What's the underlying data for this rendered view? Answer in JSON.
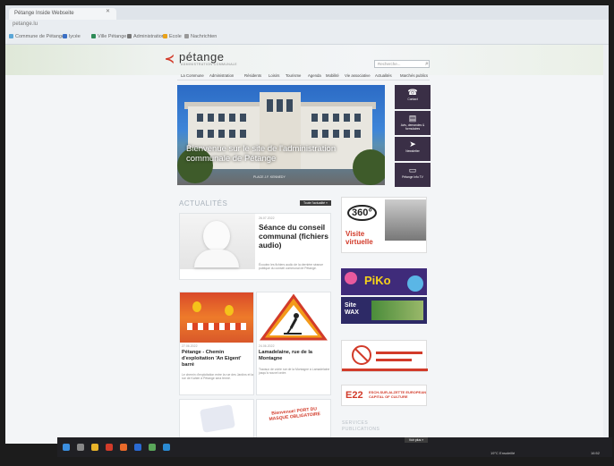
{
  "browser": {
    "tab_title": "Pétange Inside Webseite",
    "url_text": "petange.lu",
    "bookmarks": [
      "Commune de Pétange",
      "lycée",
      "Ville Pétange",
      "Administration",
      "Ecole",
      "Nachrichten"
    ]
  },
  "site": {
    "logo_text": "pétange",
    "logo_sub": "ADMINISTRATION COMMUNALE",
    "search_placeholder": "Recherche...",
    "nav": [
      "La Commune",
      "Administration",
      "Résidents",
      "Loisirs",
      "Tourisme",
      "Agenda",
      "Mobilité",
      "Vie associative",
      "Actualités",
      "Marchés publics"
    ],
    "hero": {
      "caption": "Bienvenue sur le site de l'administration communale de Pétange",
      "credit": "PLACE J.F. KENNEDY"
    },
    "side_buttons": [
      {
        "icon": "phone-book-icon",
        "glyph": "☎",
        "label": "Contact"
      },
      {
        "icon": "document-icon",
        "glyph": "▤",
        "label": "Avis, demandes & formulaires"
      },
      {
        "icon": "paper-plane-icon",
        "glyph": "➤",
        "label": "Newsletter"
      },
      {
        "icon": "tv-icon",
        "glyph": "▭",
        "label": "Pétange Info TV"
      }
    ],
    "news_section": "ACTUALITÉS",
    "all_news_label": "Toute l'actualité »",
    "cards": [
      {
        "date": "26.07.2022",
        "title": "Séance du conseil communal (fichiers audio)",
        "desc": "Écoutez les fichiers audio de la dernière séance publique du conseil communal de Pétange."
      },
      {
        "date": "27.06.2022",
        "title": "Pétange - Chemin d'exploitation 'An Eigent' barré",
        "desc": "Le chemin d'exploitation entre la rue des Jardins et la rue de Kahler à Pétange sera fermé."
      },
      {
        "date": "24.06.2022",
        "title": "Lamadelaine, rue de la Montagne",
        "desc": "Travaux de voirie rue de la Montagne à Lamadelaine jusqu'à nouvel ordre."
      }
    ],
    "banners": {
      "visite_top": "360°",
      "visite_label": "Visite virtuelle",
      "piko": "PiKo",
      "wax_label": "Site WAX",
      "esch": "ESCH-SUR-ALZETTE EUROPEAN CAPITAL OF CULTURE",
      "esch_logo": "E22"
    },
    "services_label": "SERVICES PUBLICATIONS",
    "mask_text": "Bienvenue! PORT DU MASQUE OBLIGATOIRE",
    "more_label": "Voir plus »"
  },
  "taskbar": {
    "weather": "19°C Ensoleillé",
    "time": "16:52"
  },
  "colors": {
    "brand_red": "#d23b2a",
    "side_button_bg": "#3a2f46",
    "hero_sky": "#2c6bc5"
  }
}
